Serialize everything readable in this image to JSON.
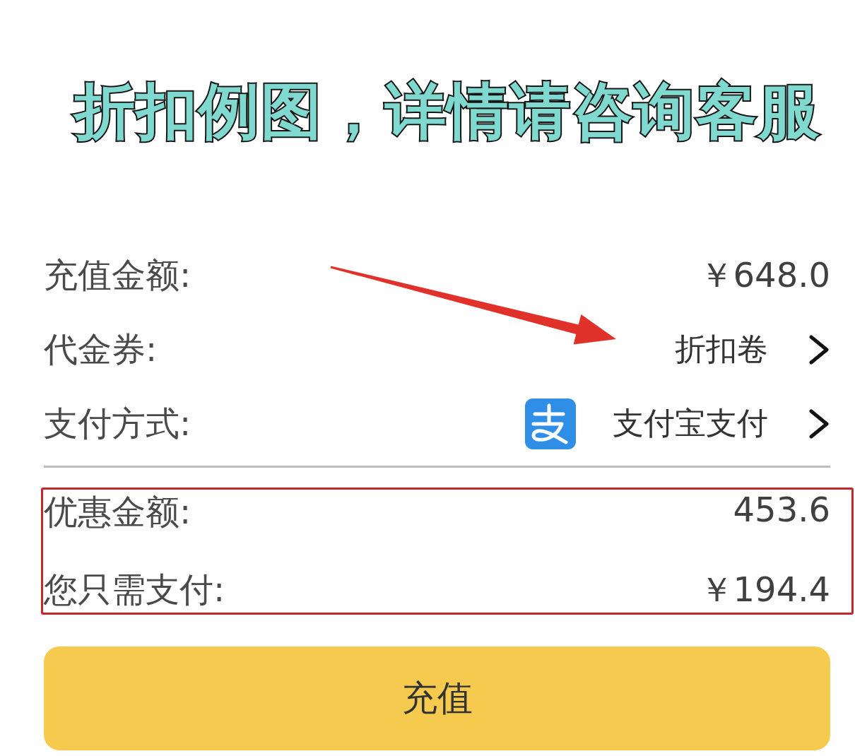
{
  "banner": {
    "text": "折扣例图，详情请咨询客服"
  },
  "rows": [
    {
      "kind": "amount",
      "label": "充值金额:",
      "value": "￥648.0"
    },
    {
      "kind": "link",
      "label": "代金券:",
      "value": "折扣卷"
    },
    {
      "kind": "payment",
      "label": "支付方式:",
      "value": "支付宝支付"
    }
  ],
  "summary": [
    {
      "label": "优惠金额:",
      "value": "453.6"
    },
    {
      "label": "您只需支付:",
      "value": "￥194.4"
    }
  ],
  "button": {
    "label": "充值"
  }
}
